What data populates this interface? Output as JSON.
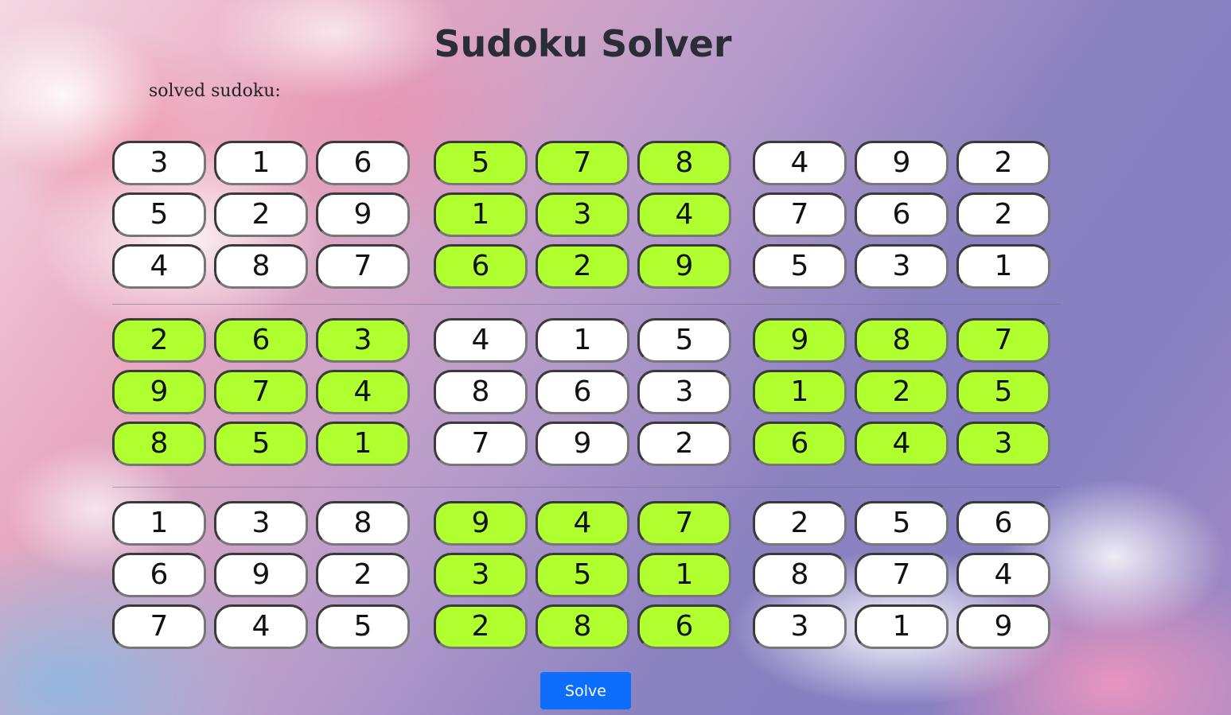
{
  "page": {
    "title": "Sudoku Solver",
    "subtitle": "solved sudoku:",
    "solve_label": "Solve"
  },
  "colors": {
    "highlight": "#b0ff2e",
    "cell_bg": "#ffffff",
    "button": "#0d6efd"
  },
  "blocks": [
    {
      "highlight": false,
      "values": [
        "3",
        "1",
        "6",
        "5",
        "2",
        "9",
        "4",
        "8",
        "7"
      ]
    },
    {
      "highlight": true,
      "values": [
        "5",
        "7",
        "8",
        "1",
        "3",
        "4",
        "6",
        "2",
        "9"
      ]
    },
    {
      "highlight": false,
      "values": [
        "4",
        "9",
        "2",
        "7",
        "6",
        "2",
        "5",
        "3",
        "1"
      ]
    },
    {
      "highlight": true,
      "values": [
        "2",
        "6",
        "3",
        "9",
        "7",
        "4",
        "8",
        "5",
        "1"
      ]
    },
    {
      "highlight": false,
      "values": [
        "4",
        "1",
        "5",
        "8",
        "6",
        "3",
        "7",
        "9",
        "2"
      ]
    },
    {
      "highlight": true,
      "values": [
        "9",
        "8",
        "7",
        "1",
        "2",
        "5",
        "6",
        "4",
        "3"
      ]
    },
    {
      "highlight": false,
      "values": [
        "1",
        "3",
        "8",
        "6",
        "9",
        "2",
        "7",
        "4",
        "5"
      ]
    },
    {
      "highlight": true,
      "values": [
        "9",
        "4",
        "7",
        "3",
        "5",
        "1",
        "2",
        "8",
        "6"
      ]
    },
    {
      "highlight": false,
      "values": [
        "2",
        "5",
        "6",
        "8",
        "7",
        "4",
        "3",
        "1",
        "9"
      ]
    }
  ]
}
